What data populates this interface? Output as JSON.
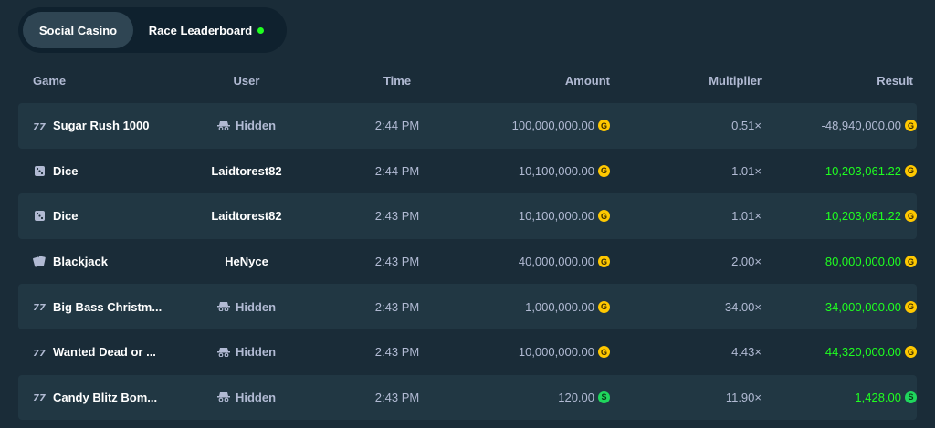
{
  "tabs": [
    {
      "label": "Social Casino",
      "active": true
    },
    {
      "label": "Race Leaderboard",
      "active": false,
      "live_indicator_color": "#1fff20"
    }
  ],
  "columns": {
    "game": "Game",
    "user": "User",
    "time": "Time",
    "amount": "Amount",
    "multiplier": "Multiplier",
    "result": "Result"
  },
  "currency": {
    "gold": "G",
    "sweeps": "S"
  },
  "colors": {
    "positive": "#1fff20",
    "neutral": "#b1bad3",
    "gold_coin": "#ffc800",
    "sweeps_coin": "#1fd65c"
  },
  "rows": [
    {
      "game_icon": "slots-icon",
      "game": "Sugar Rush 1000",
      "user": "Hidden",
      "user_hidden": true,
      "time": "2:44 PM",
      "amount": "100,000,000.00",
      "coin": "gold",
      "multiplier": "0.51×",
      "result": "-48,940,000.00",
      "positive": false
    },
    {
      "game_icon": "dice-icon",
      "game": "Dice",
      "user": "Laidtorest82",
      "user_hidden": false,
      "time": "2:44 PM",
      "amount": "10,100,000.00",
      "coin": "gold",
      "multiplier": "1.01×",
      "result": "10,203,061.22",
      "positive": true
    },
    {
      "game_icon": "dice-icon",
      "game": "Dice",
      "user": "Laidtorest82",
      "user_hidden": false,
      "time": "2:43 PM",
      "amount": "10,100,000.00",
      "coin": "gold",
      "multiplier": "1.01×",
      "result": "10,203,061.22",
      "positive": true
    },
    {
      "game_icon": "cards-icon",
      "game": "Blackjack",
      "user": "HeNyce",
      "user_hidden": false,
      "time": "2:43 PM",
      "amount": "40,000,000.00",
      "coin": "gold",
      "multiplier": "2.00×",
      "result": "80,000,000.00",
      "positive": true
    },
    {
      "game_icon": "slots-icon",
      "game": "Big Bass Christm...",
      "user": "Hidden",
      "user_hidden": true,
      "time": "2:43 PM",
      "amount": "1,000,000.00",
      "coin": "gold",
      "multiplier": "34.00×",
      "result": "34,000,000.00",
      "positive": true
    },
    {
      "game_icon": "slots-icon",
      "game": "Wanted Dead or ...",
      "user": "Hidden",
      "user_hidden": true,
      "time": "2:43 PM",
      "amount": "10,000,000.00",
      "coin": "gold",
      "multiplier": "4.43×",
      "result": "44,320,000.00",
      "positive": true
    },
    {
      "game_icon": "slots-icon",
      "game": "Candy Blitz Bom...",
      "user": "Hidden",
      "user_hidden": true,
      "time": "2:43 PM",
      "amount": "120.00",
      "coin": "sweeps",
      "multiplier": "11.90×",
      "result": "1,428.00",
      "positive": true
    }
  ]
}
